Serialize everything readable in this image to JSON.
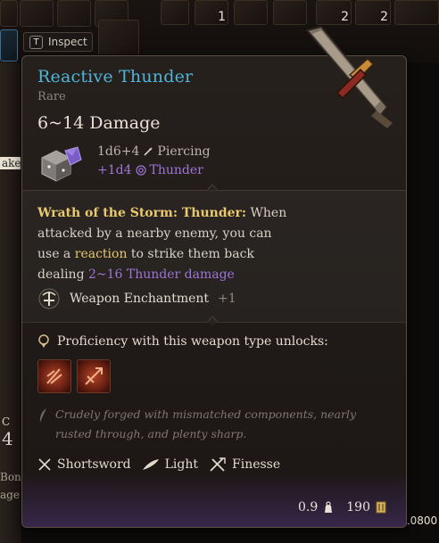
{
  "inventory": {
    "inspect_key": "T",
    "inspect_label": "Inspect",
    "slot_counts": [
      "1",
      "2",
      "2"
    ],
    "left_fragments": [
      "ake",
      "C",
      "4",
      "Bon",
      "age"
    ],
    "right_fragment": "10800"
  },
  "tooltip": {
    "title": "Reactive Thunder",
    "rarity": "Rare",
    "damage_total": "6~14 Damage",
    "base_damage": "1d6+4",
    "base_damage_type": "Piercing",
    "bonus_damage": "+1d4",
    "bonus_damage_type": "Thunder",
    "passive": {
      "name": "Wrath of the Storm: Thunder:",
      "text_1": "When attacked by a nearby enemy, you can use a",
      "reaction_word": "reaction",
      "text_2": "to strike them back dealing",
      "damage_value": "2~16",
      "damage_label": "Thunder damage"
    },
    "enchantment_label": "Weapon Enchantment",
    "enchantment_value": "+1",
    "proficiency_label": "Proficiency with this weapon type unlocks:",
    "flavor_text": "Crudely forged with mismatched components, nearly rusted through, and plenty sharp.",
    "properties": [
      {
        "icon": "shortsword-icon",
        "label": "Shortsword"
      },
      {
        "icon": "feather-icon",
        "label": "Light"
      },
      {
        "icon": "finesse-icon",
        "label": "Finesse"
      }
    ],
    "weight": "0.9",
    "value": "190"
  },
  "colors": {
    "title": "#4fb4d8",
    "thunder": "#9f74d9",
    "passive_name": "#e9c96e",
    "flavor": "#807870"
  }
}
